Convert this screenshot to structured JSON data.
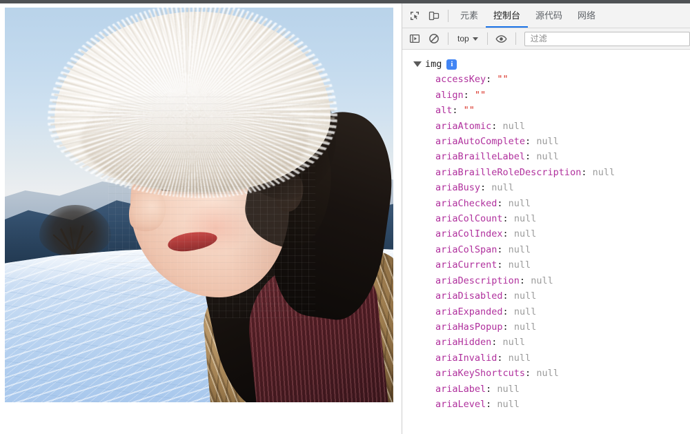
{
  "browser": {
    "chrome_strip_color": "#4f5255"
  },
  "page": {
    "image": {
      "alt": "",
      "description": "winter portrait, woman in white fur hat on snowy field with mountains"
    }
  },
  "devtools": {
    "toolbar": {
      "inspect_icon": "inspect-element-icon",
      "device_toolbar_icon": "device-toolbar-icon",
      "tabs": [
        {
          "label": "元素",
          "name": "elements",
          "active": false
        },
        {
          "label": "控制台",
          "name": "console",
          "active": true
        },
        {
          "label": "源代码",
          "name": "sources",
          "active": false
        },
        {
          "label": "网络",
          "name": "network",
          "active": false
        }
      ],
      "active_tab_underline_color": "#1a73e8"
    },
    "console_toolbar": {
      "sidebar_toggle_icon": "console-sidebar-icon",
      "clear_icon": "clear-console-icon",
      "context_label": "top",
      "context_caret": "chevron-down-icon",
      "eye_icon": "live-expression-eye-icon",
      "filter_placeholder": "过滤",
      "filter_value": ""
    },
    "console_output": {
      "object_name": "img",
      "expanded": true,
      "badge": "info-badge",
      "badge_color": "#4285f4",
      "properties": [
        {
          "key": "accessKey",
          "value": "\"\"",
          "type": "string"
        },
        {
          "key": "align",
          "value": "\"\"",
          "type": "string"
        },
        {
          "key": "alt",
          "value": "\"\"",
          "type": "string"
        },
        {
          "key": "ariaAtomic",
          "value": "null",
          "type": "null"
        },
        {
          "key": "ariaAutoComplete",
          "value": "null",
          "type": "null"
        },
        {
          "key": "ariaBrailleLabel",
          "value": "null",
          "type": "null"
        },
        {
          "key": "ariaBrailleRoleDescription",
          "value": "null",
          "type": "null"
        },
        {
          "key": "ariaBusy",
          "value": "null",
          "type": "null"
        },
        {
          "key": "ariaChecked",
          "value": "null",
          "type": "null"
        },
        {
          "key": "ariaColCount",
          "value": "null",
          "type": "null"
        },
        {
          "key": "ariaColIndex",
          "value": "null",
          "type": "null"
        },
        {
          "key": "ariaColSpan",
          "value": "null",
          "type": "null"
        },
        {
          "key": "ariaCurrent",
          "value": "null",
          "type": "null"
        },
        {
          "key": "ariaDescription",
          "value": "null",
          "type": "null"
        },
        {
          "key": "ariaDisabled",
          "value": "null",
          "type": "null"
        },
        {
          "key": "ariaExpanded",
          "value": "null",
          "type": "null"
        },
        {
          "key": "ariaHasPopup",
          "value": "null",
          "type": "null"
        },
        {
          "key": "ariaHidden",
          "value": "null",
          "type": "null"
        },
        {
          "key": "ariaInvalid",
          "value": "null",
          "type": "null"
        },
        {
          "key": "ariaKeyShortcuts",
          "value": "null",
          "type": "null"
        },
        {
          "key": "ariaLabel",
          "value": "null",
          "type": "null"
        },
        {
          "key": "ariaLevel",
          "value": "null",
          "type": "null"
        }
      ],
      "colors": {
        "property_key": "#b0309d",
        "null_value": "#9b9b9b",
        "string_value": "#d93025"
      }
    }
  }
}
